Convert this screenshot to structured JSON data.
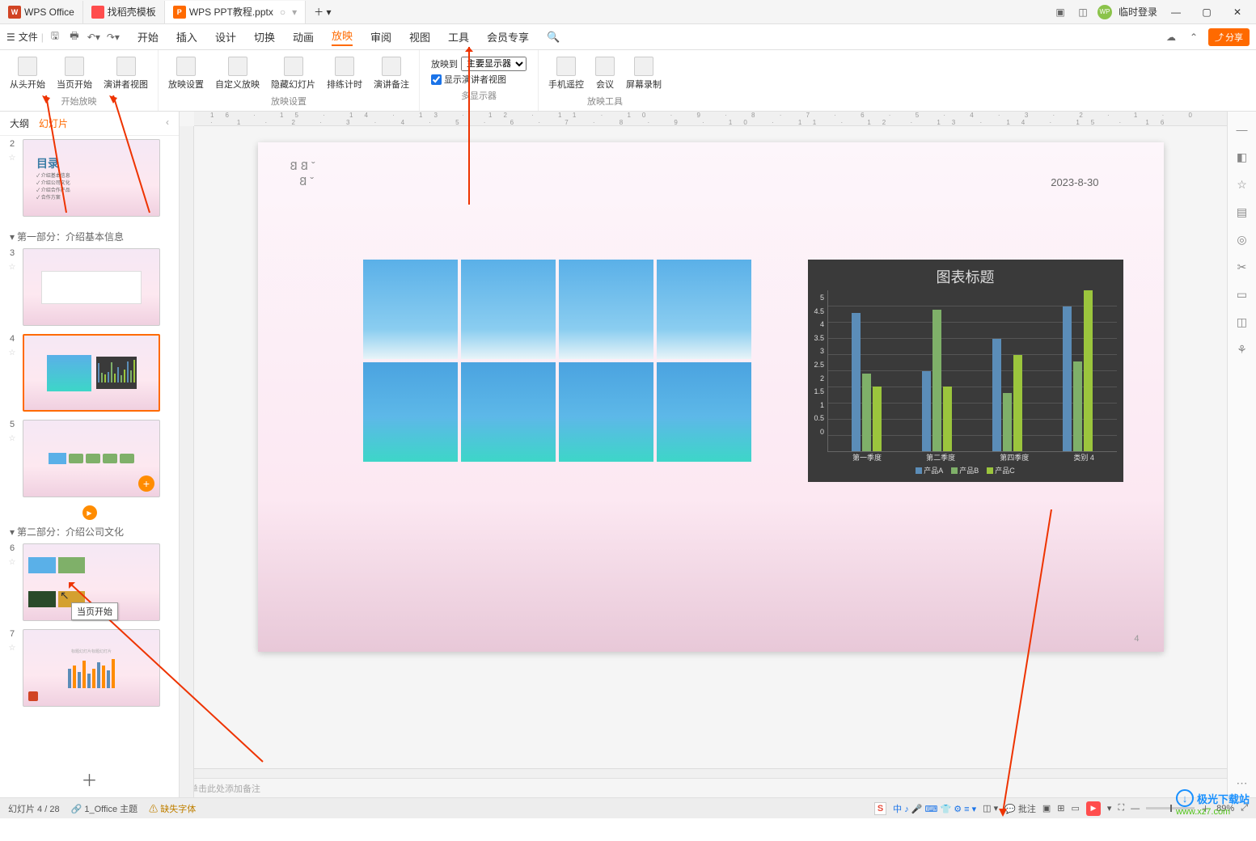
{
  "titlebar": {
    "tabs": [
      {
        "label": "WPS Office"
      },
      {
        "label": "找稻壳模板"
      },
      {
        "label": "WPS PPT教程.pptx"
      }
    ],
    "login": "临时登录"
  },
  "toolbar": {
    "file": "文件"
  },
  "menu": {
    "items": [
      "开始",
      "插入",
      "设计",
      "切换",
      "动画",
      "放映",
      "审阅",
      "视图",
      "工具",
      "会员专享"
    ],
    "activeIndex": 5
  },
  "ribbon": {
    "g1": {
      "items": [
        "从头开始",
        "当页开始",
        "演讲者视图"
      ],
      "label": "开始放映"
    },
    "g2": {
      "items": [
        "放映设置",
        "自定义放映",
        "隐藏幻灯片",
        "排练计时",
        "演讲备注"
      ],
      "label": "放映设置"
    },
    "g3": {
      "sendto": "放映到",
      "display": "主要显示器",
      "show_presenter": "显示演讲者视图",
      "label": "多显示器"
    },
    "g4": {
      "items": [
        "手机遥控",
        "会议",
        "屏幕录制"
      ],
      "label": "放映工具"
    }
  },
  "share": "分享",
  "panel": {
    "tabs": [
      "大纲",
      "幻灯片"
    ],
    "section1": "第一部分：介绍基本信息",
    "section2": "第二部分：介绍公司文化",
    "tooltip": "当页开始",
    "toc_title": "目录",
    "toc_items": [
      "介绍基本信息",
      "介绍公司文化",
      "介绍合作产品",
      "合作方案"
    ]
  },
  "slide": {
    "date": "2023-8-30",
    "page_num": "4"
  },
  "chart_data": {
    "type": "bar",
    "title": "图表标题",
    "categories": [
      "第一季度",
      "第二季度",
      "第四季度",
      "类别 4"
    ],
    "series": [
      {
        "name": "产品A",
        "values": [
          4.3,
          2.5,
          3.5,
          4.5
        ]
      },
      {
        "name": "产品B",
        "values": [
          2.4,
          4.4,
          1.8,
          2.8
        ]
      },
      {
        "name": "产品C",
        "values": [
          2.0,
          2.0,
          3.0,
          5.0
        ]
      }
    ],
    "ylim": [
      0,
      5
    ],
    "yticks": [
      0,
      0.5,
      1,
      1.5,
      2,
      2.5,
      3,
      3.5,
      4,
      4.5,
      5
    ]
  },
  "notes": {
    "placeholder": "单击此处添加备注"
  },
  "status": {
    "slide": "幻灯片 4 / 28",
    "theme": "1_Office 主题",
    "missing": "缺失字体",
    "comments": "批注",
    "zoom": "89%"
  },
  "ruler": "16 · 15 · 14 · 13 · 12 · 11 · 10 · 9 · 8 · 7 · 6 · 5 · 4 · 3 · 2 · 1 · 0 · 1 · 2 · 3 · 4 · 5 · 6 · 7 · 8 · 9 · 10 · 11 · 12 · 13 · 14 · 15 · 16",
  "watermark": {
    "l1": "极光下载站",
    "l2": "www.xz7.com"
  }
}
